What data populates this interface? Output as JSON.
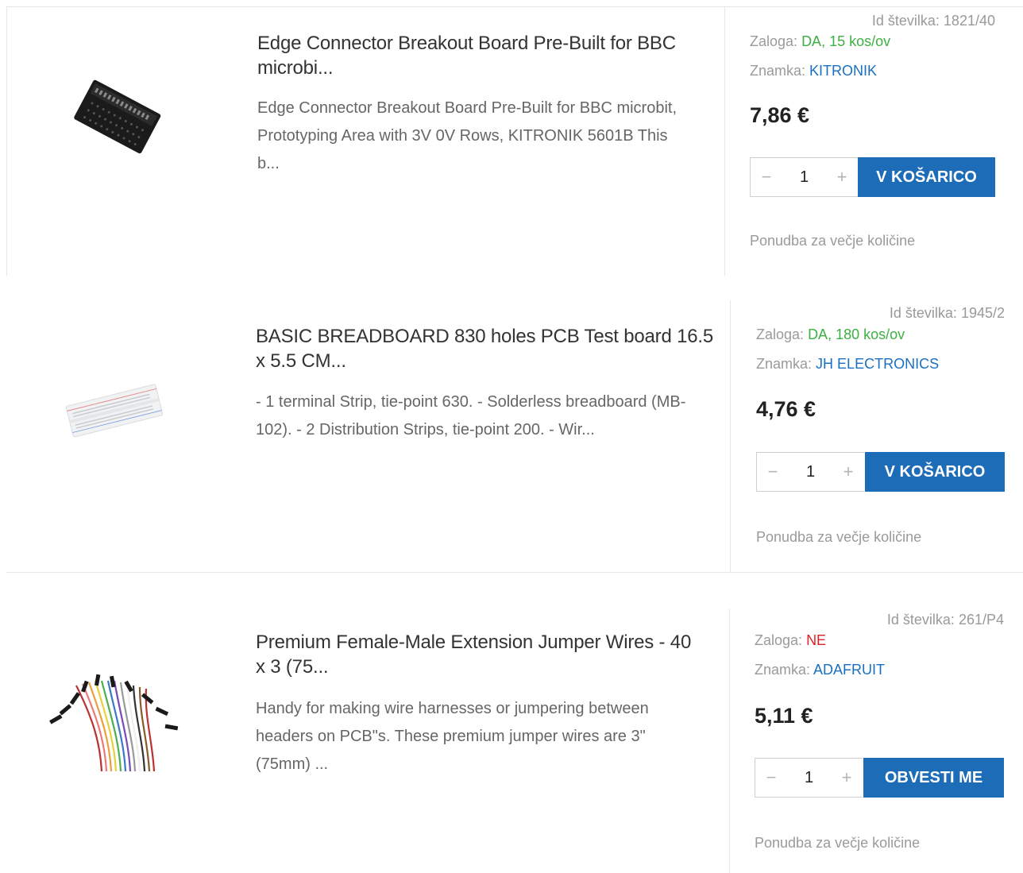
{
  "labels": {
    "id_prefix": "Id številka:",
    "stock_prefix": "Zaloga:",
    "brand_prefix": "Znamka:",
    "offer": "Ponudba za večje količine"
  },
  "products": [
    {
      "title_line1": "Edge Connector Breakout Board Pre-Built for BBC",
      "title_line2": "microbi...",
      "desc_line1": "Edge Connector Breakout Board Pre-Built for BBC microbit,",
      "desc_line2": "Prototyping Area with 3V 0V Rows, KITRONIK 5601B   This",
      "desc_line3": "b...",
      "id": "1821/40",
      "stock": "DA, 15 kos/ov",
      "stock_status": "in-stock",
      "brand": "KITRONIK",
      "price": "7,86 €",
      "qty": "1",
      "button": "V KOŠARICO",
      "image_icon": "edge-connector-board-image"
    },
    {
      "title_line1": "BASIC BREADBOARD 830 holes PCB Test board 16.5",
      "title_line2": "x 5.5 CM...",
      "desc_line1": "- 1 terminal Strip, tie-point 630. - Solderless breadboard (MB-",
      "desc_line2": "102). - 2 Distribution Strips, tie-point 200.  - Wir...",
      "desc_line3": "",
      "id": "1945/2",
      "stock": "DA, 180 kos/ov",
      "stock_status": "in-stock",
      "brand": "JH ELECTRONICS",
      "price": "4,76 €",
      "qty": "1",
      "button": "V KOŠARICO",
      "image_icon": "breadboard-image"
    },
    {
      "title_line1": "Premium Female-Male Extension Jumper Wires - 40",
      "title_line2": "x 3 (75...",
      "desc_line1": "Handy for making wire harnesses or jumpering between",
      "desc_line2": "headers on PCB\"s. These premium jumper wires are 3\"",
      "desc_line3": "(75mm) ...",
      "id": "261/P4",
      "stock": "NE",
      "stock_status": "out-of-stock",
      "brand": "ADAFRUIT",
      "price": "5,11 €",
      "qty": "1",
      "button": "OBVESTI ME",
      "image_icon": "jumper-wires-image"
    }
  ],
  "colors": {
    "accent": "#1c6cb8",
    "in_stock": "#3cb043",
    "out_of_stock": "#e01f26",
    "brand_link": "#1a70c0"
  }
}
